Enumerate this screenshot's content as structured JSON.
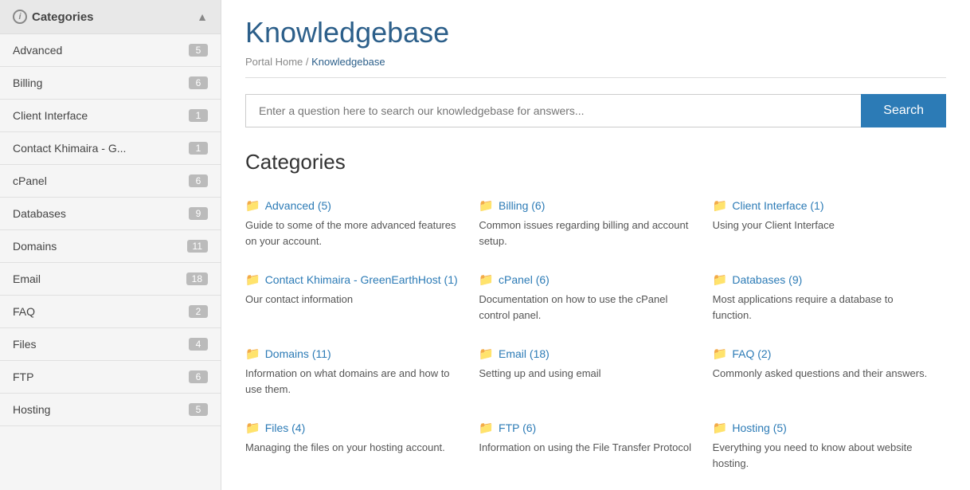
{
  "sidebar": {
    "header": "Categories",
    "chevron": "▲",
    "info_icon": "i",
    "items": [
      {
        "label": "Advanced",
        "count": 5
      },
      {
        "label": "Billing",
        "count": 6
      },
      {
        "label": "Client Interface",
        "count": 1
      },
      {
        "label": "Contact Khimaira - G...",
        "count": 1
      },
      {
        "label": "cPanel",
        "count": 6
      },
      {
        "label": "Databases",
        "count": 9
      },
      {
        "label": "Domains",
        "count": 11
      },
      {
        "label": "Email",
        "count": 18
      },
      {
        "label": "FAQ",
        "count": 2
      },
      {
        "label": "Files",
        "count": 4
      },
      {
        "label": "FTP",
        "count": 6
      },
      {
        "label": "Hosting",
        "count": 5
      }
    ]
  },
  "main": {
    "page_title": "Knowledgebase",
    "breadcrumb_home": "Portal Home",
    "breadcrumb_separator": "/",
    "breadcrumb_current": "Knowledgebase",
    "search_placeholder": "Enter a question here to search our knowledgebase for answers...",
    "search_button": "Search",
    "categories_title": "Categories",
    "categories": [
      {
        "label": "Advanced (5)",
        "href": "#",
        "desc": "Guide to some of the more advanced features on your account."
      },
      {
        "label": "Billing (6)",
        "href": "#",
        "desc": "Common issues regarding billing and account setup."
      },
      {
        "label": "Client Interface (1)",
        "href": "#",
        "desc": "Using your Client Interface"
      },
      {
        "label": "Contact Khimaira - GreenEarthHost (1)",
        "href": "#",
        "desc": "Our contact information"
      },
      {
        "label": "cPanel (6)",
        "href": "#",
        "desc": "Documentation on how to use the cPanel control panel."
      },
      {
        "label": "Databases (9)",
        "href": "#",
        "desc": "Most applications require a database to function."
      },
      {
        "label": "Domains (11)",
        "href": "#",
        "desc": "Information on what domains are and how to use them."
      },
      {
        "label": "Email (18)",
        "href": "#",
        "desc": "Setting up and using email"
      },
      {
        "label": "FAQ (2)",
        "href": "#",
        "desc": "Commonly asked questions and their answers."
      },
      {
        "label": "Files (4)",
        "href": "#",
        "desc": "Managing the files on your hosting account."
      },
      {
        "label": "FTP (6)",
        "href": "#",
        "desc": "Information on using the File Transfer Protocol"
      },
      {
        "label": "Hosting (5)",
        "href": "#",
        "desc": "Everything you need to know about website hosting."
      }
    ]
  }
}
